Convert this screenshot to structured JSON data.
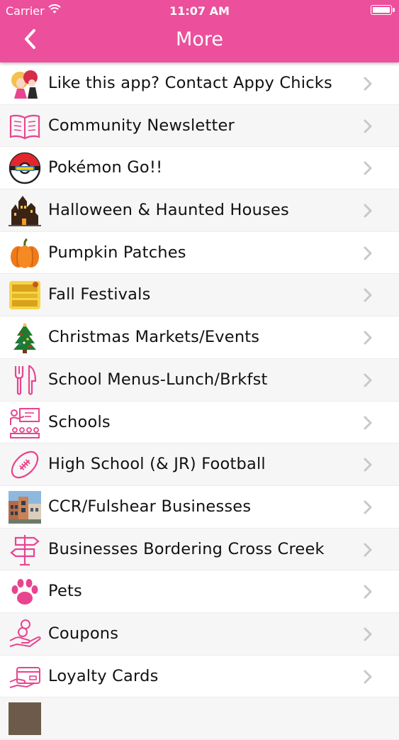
{
  "status_bar": {
    "carrier": "Carrier",
    "time": "11:07 AM"
  },
  "nav": {
    "title": "More",
    "back_icon": "chevron-left-icon"
  },
  "colors": {
    "nav_background": "#ec4f9c",
    "icon_pink": "#e8448f",
    "chevron": "#c7c7cc"
  },
  "menu": {
    "items": [
      {
        "label": "Like this app? Contact Appy Chicks",
        "icon": "appy-chicks-logo-icon"
      },
      {
        "label": "Community Newsletter",
        "icon": "open-book-icon"
      },
      {
        "label": "Pokémon Go!!",
        "icon": "pokeball-icon"
      },
      {
        "label": "Halloween & Haunted Houses",
        "icon": "haunted-house-icon"
      },
      {
        "label": "Pumpkin Patches",
        "icon": "pumpkin-icon"
      },
      {
        "label": "Fall Festivals",
        "icon": "fall-festival-logo-icon"
      },
      {
        "label": "Christmas Markets/Events",
        "icon": "christmas-tree-icon"
      },
      {
        "label": "School Menus-Lunch/Brkfst",
        "icon": "fork-knife-icon"
      },
      {
        "label": "Schools",
        "icon": "classroom-icon"
      },
      {
        "label": "High School (& JR) Football",
        "icon": "football-icon"
      },
      {
        "label": "CCR/Fulshear Businesses",
        "icon": "building-photo-icon"
      },
      {
        "label": "Businesses Bordering Cross Creek",
        "icon": "signpost-icon"
      },
      {
        "label": "Pets",
        "icon": "paw-icon"
      },
      {
        "label": "Coupons",
        "icon": "coin-hand-icon"
      },
      {
        "label": "Loyalty Cards",
        "icon": "loyalty-card-icon"
      }
    ]
  }
}
